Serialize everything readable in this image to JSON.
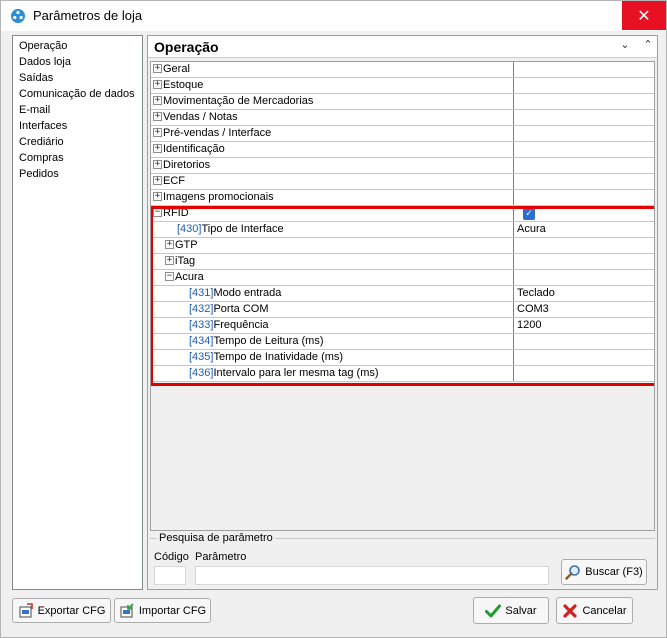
{
  "window": {
    "title": "Parâmetros de loja",
    "close_label": "✕"
  },
  "nav": {
    "items": [
      "Operação",
      "Dados loja",
      "Saídas",
      "Comunicação de dados",
      "E-mail",
      "Interfaces",
      "Crediário",
      "Compras",
      "Pedidos"
    ]
  },
  "section": {
    "title": "Operação",
    "collapse_icon": "⌄",
    "scroll_icon": "⌃"
  },
  "tree": {
    "rows": [
      {
        "exp": "+",
        "code": "",
        "label": "Geral",
        "value": "",
        "indent": 0
      },
      {
        "exp": "+",
        "code": "",
        "label": "Estoque",
        "value": "",
        "indent": 0
      },
      {
        "exp": "+",
        "code": "",
        "label": "Movimentação de Mercadorias",
        "value": "",
        "indent": 0
      },
      {
        "exp": "+",
        "code": "",
        "label": "Vendas / Notas",
        "value": "",
        "indent": 0
      },
      {
        "exp": "+",
        "code": "",
        "label": "Pré-vendas / Interface",
        "value": "",
        "indent": 0
      },
      {
        "exp": "+",
        "code": "",
        "label": "Identificação",
        "value": "",
        "indent": 0
      },
      {
        "exp": "+",
        "code": "",
        "label": "Diretorios",
        "value": "",
        "indent": 0
      },
      {
        "exp": "+",
        "code": "",
        "label": "ECF",
        "value": "",
        "indent": 0
      },
      {
        "exp": "+",
        "code": "",
        "label": "Imagens promocionais",
        "value": "",
        "indent": 0
      },
      {
        "exp": "−",
        "code": "",
        "label": "RFID",
        "value": "",
        "indent": 0,
        "checked": true
      },
      {
        "exp": "",
        "code": "[430]",
        "label": "Tipo de Interface",
        "value": "Acura",
        "indent": 2
      },
      {
        "exp": "+",
        "code": "",
        "label": "GTP",
        "value": "",
        "indent": 1
      },
      {
        "exp": "+",
        "code": "",
        "label": "iTag",
        "value": "",
        "indent": 1
      },
      {
        "exp": "−",
        "code": "",
        "label": "Acura",
        "value": "",
        "indent": 1
      },
      {
        "exp": "",
        "code": "[431]",
        "label": "Modo entrada",
        "value": "Teclado",
        "indent": 3
      },
      {
        "exp": "",
        "code": "[432]",
        "label": "Porta COM",
        "value": "COM3",
        "indent": 3
      },
      {
        "exp": "",
        "code": "[433]",
        "label": "Frequência",
        "value": "1200",
        "indent": 3
      },
      {
        "exp": "",
        "code": "[434]",
        "label": "Tempo de Leitura (ms)",
        "value": "",
        "indent": 3
      },
      {
        "exp": "",
        "code": "[435]",
        "label": "Tempo de Inatividade (ms)",
        "value": "",
        "indent": 3
      },
      {
        "exp": "",
        "code": "[436]",
        "label": "Intervalo para ler mesma tag (ms)",
        "value": "",
        "indent": 3
      }
    ]
  },
  "search": {
    "legend": "Pesquisa de parâmetro",
    "codigo_label": "Código",
    "parametro_label": "Parâmetro",
    "codigo_value": "",
    "parametro_value": "",
    "button_label": "Buscar (F3)"
  },
  "footer": {
    "export_label": "Exportar CFG",
    "import_label": "Importar CFG",
    "save_label": "Salvar",
    "cancel_label": "Cancelar"
  },
  "colors": {
    "highlight": "#e30000",
    "code": "#1e5db5",
    "close_bg": "#e81123",
    "check": "#2b6dd0"
  }
}
